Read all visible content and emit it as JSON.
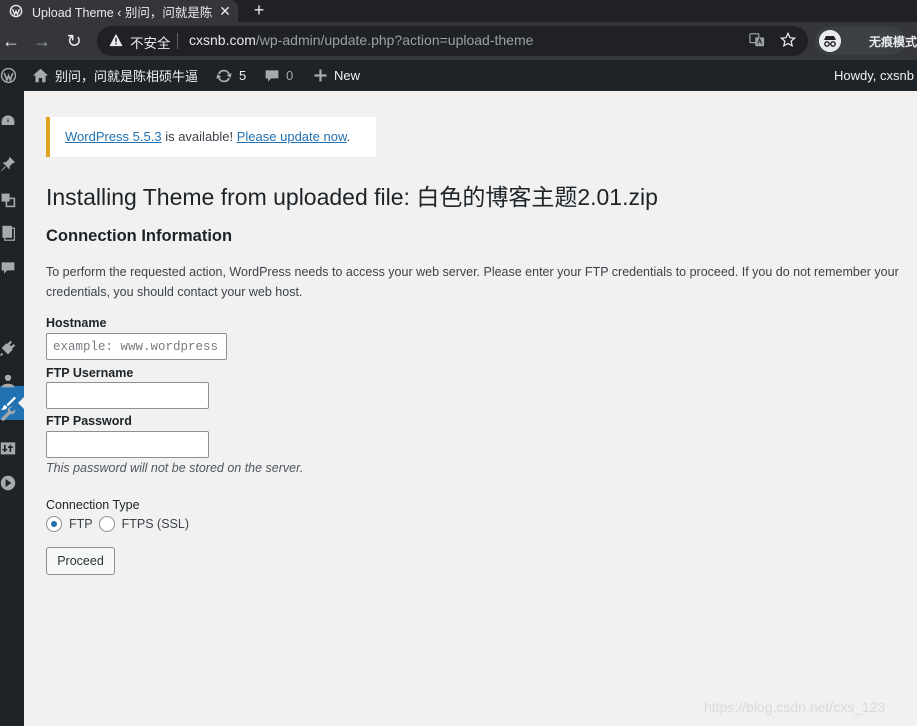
{
  "browser": {
    "tab_title": "Upload Theme ‹ 别问，问就是陈",
    "tab_close": "✕",
    "new_tab": "+",
    "back": "←",
    "forward": "→",
    "reload": "↻",
    "insecure_label": "不安全",
    "url_host": "cxsnb.com",
    "url_path": "/wp-admin/update.php?action=upload-theme",
    "incognito_label": "无痕模式"
  },
  "adminbar": {
    "site_name": "别问，问就是陈相硕牛逼",
    "updates_count": "5",
    "comments_count": "0",
    "new_label": "New",
    "howdy": "Howdy, cxsnb"
  },
  "notice": {
    "version_link": "WordPress 5.5.3",
    "middle_text": " is available! ",
    "update_link": "Please update now",
    "end": "."
  },
  "page": {
    "title": "Installing Theme from uploaded file: 白色的博客主题2.01.zip",
    "section_title": "Connection Information",
    "description": "To perform the requested action, WordPress needs to access your web server. Please enter your FTP credentials to proceed. If you do not remember your credentials, you should contact your web host."
  },
  "form": {
    "hostname_label": "Hostname",
    "hostname_placeholder": "example: www.wordpress.org",
    "username_label": "FTP Username",
    "password_label": "FTP Password",
    "password_hint": "This password will not be stored on the server.",
    "connection_type_label": "Connection Type",
    "option_ftp": "FTP",
    "option_ftps": "FTPS (SSL)",
    "proceed_label": "Proceed"
  },
  "watermark": "https://blog.csdn.net/cxs_123",
  "colors": {
    "admin_bar": "#1d2327",
    "accent": "#2271b1",
    "notice_warning": "#dba617",
    "background": "#f1f1f1"
  }
}
